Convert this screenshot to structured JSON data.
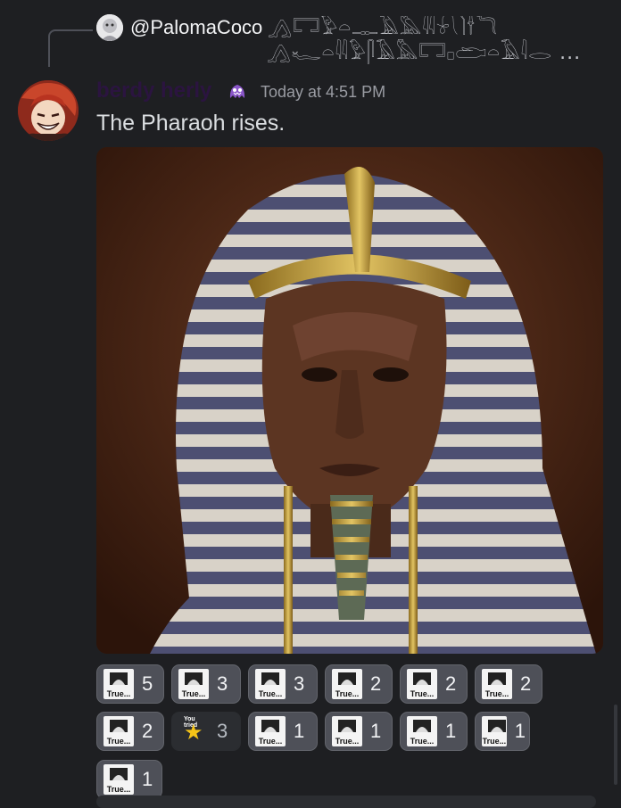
{
  "reply": {
    "username": "@PalomaCoco",
    "preview_line1": "𓂻𓉐𓅱𓏏𓊃𓄿𓅓𓇌𓍯𓌙𓌂𓆓",
    "preview_line2": "𓂻𓅓𓅱𓊃𓏭𓂋𓅃𓇋𓋴𓂻𓆑𓏏𓇌𓅱𓋴𓄿𓅓𓉐𓊪𓂧𓏏𓄿𓇋𓂋 ..."
  },
  "message": {
    "username": "berdy herly",
    "timestamp": "Today at 4:51 PM",
    "text": "The Pharaoh rises."
  },
  "attachment": {
    "icon": "pharaoh-portrait-image"
  },
  "reactions": [
    {
      "emoji_text": "True...",
      "count": "5",
      "style": "active"
    },
    {
      "emoji_text": "True...",
      "count": "3",
      "style": "active"
    },
    {
      "emoji_text": "True...",
      "count": "3",
      "style": "active"
    },
    {
      "emoji_text": "True...",
      "count": "2",
      "style": "active"
    },
    {
      "emoji_text": "True...",
      "count": "2",
      "style": "active"
    },
    {
      "emoji_text": "True...",
      "count": "2",
      "style": "active"
    },
    {
      "emoji_text": "True...",
      "count": "2",
      "style": "active"
    },
    {
      "emoji_text": "You tried",
      "count": "3",
      "style": "inactive"
    },
    {
      "emoji_text": "True...",
      "count": "1",
      "style": "active"
    },
    {
      "emoji_text": "True...",
      "count": "1",
      "style": "active"
    },
    {
      "emoji_text": "True...",
      "count": "1",
      "style": "active"
    },
    {
      "emoji_text": "True...",
      "count": "1",
      "style": "active"
    },
    {
      "emoji_text": "True...",
      "count": "1",
      "style": "active"
    }
  ],
  "colors": {
    "background": "#1e1f22",
    "username": "#2b1440",
    "reaction_bg": "#4e5058",
    "reaction_inactive_bg": "#2b2d31"
  }
}
